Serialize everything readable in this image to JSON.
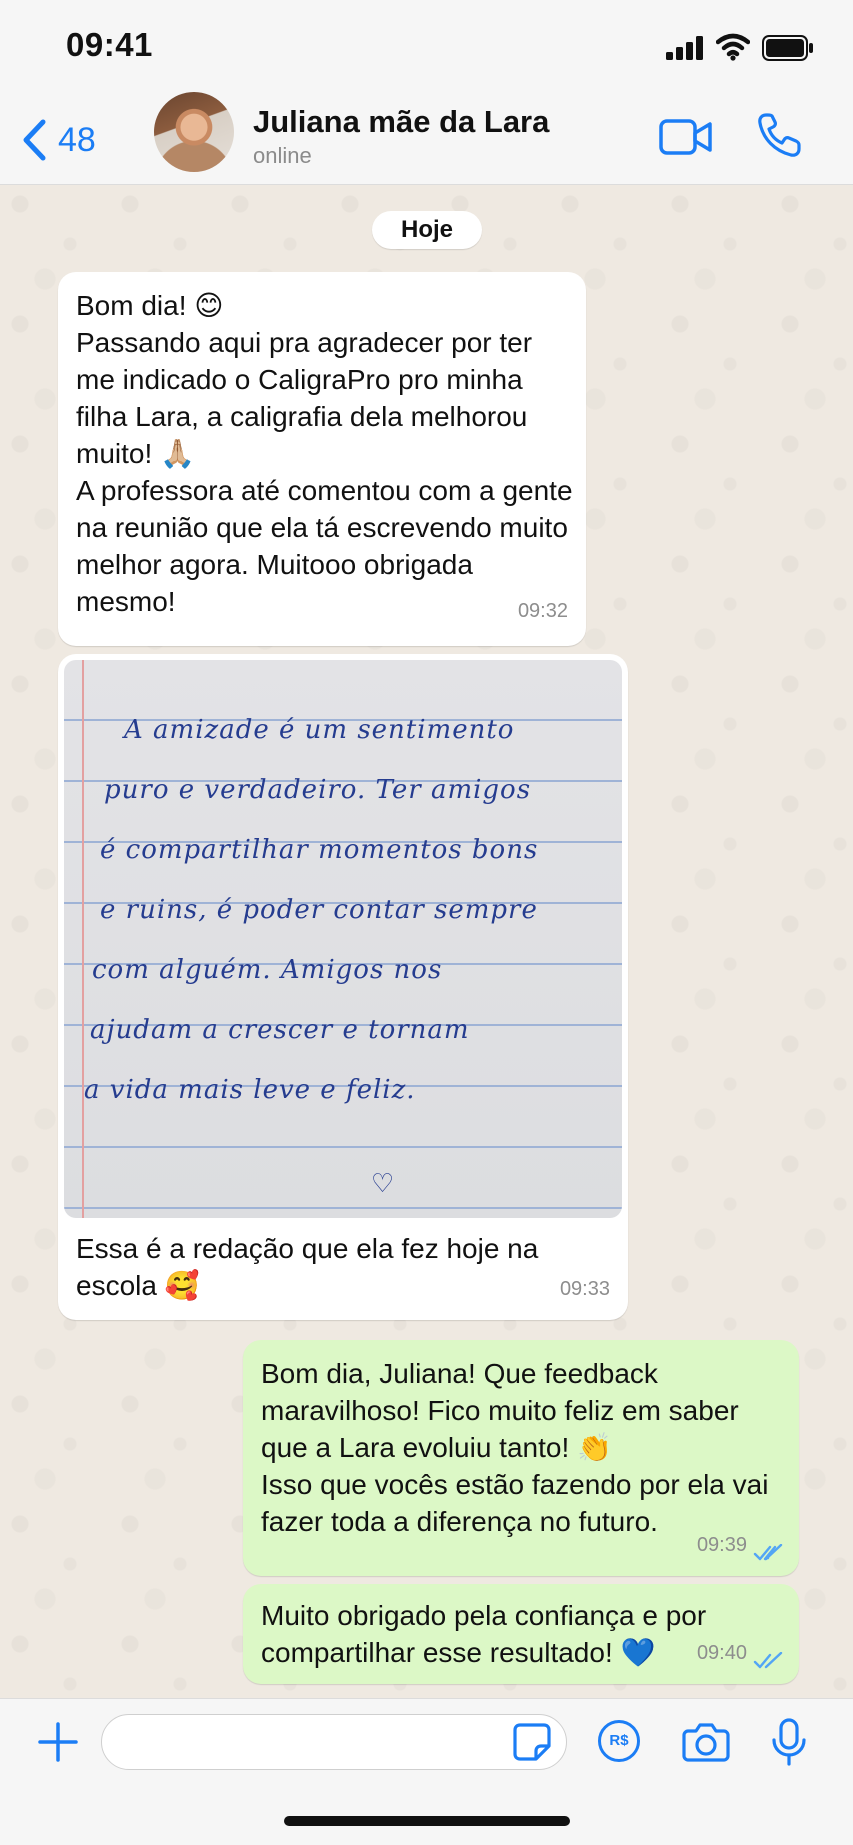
{
  "status_bar": {
    "time": "09:41"
  },
  "header": {
    "back_count": "48",
    "contact_name": "Juliana mãe da Lara",
    "contact_status": "online"
  },
  "date_chip": "Hoje",
  "messages": [
    {
      "direction": "incoming",
      "text": "Bom dia! 😊\nPassando aqui pra agradecer por ter me indicado o CaligraPro pro minha filha Lara, a caligrafia dela melhorou muito! 🙏🏼\nA professora até comentou com a gente na reunião que ela tá escrevendo muito melhor agora. Muitooo obrigada mesmo!",
      "time": "09:32"
    },
    {
      "direction": "incoming",
      "photo_lines": [
        "A amizade é um sentimento",
        "puro e verdadeiro. Ter amigos",
        "é compartilhar momentos bons",
        "e ruins, é poder contar sempre",
        "com alguém. Amigos nos",
        "ajudam a crescer e tornam",
        "a vida mais leve e feliz.",
        "♡"
      ],
      "text": "Essa é a redação que ela fez hoje na escola 🥰",
      "time": "09:33"
    },
    {
      "direction": "outgoing",
      "text": "Bom dia, Juliana! Que feedback maravilhoso! Fico muito feliz em saber que a Lara evoluiu tanto! 👏\nIsso que vocês estão fazendo por ela vai fazer toda a diferença no futuro.",
      "time": "09:39",
      "status": "read"
    },
    {
      "direction": "outgoing",
      "text": "Muito obrigado pela confiança e por compartilhar esse resultado! 💙",
      "time": "09:40",
      "status": "read"
    }
  ],
  "input": {
    "placeholder": "",
    "value": ""
  },
  "icons": {
    "back": "chevron-left-icon",
    "video_call": "video-camera-icon",
    "voice_call": "phone-icon",
    "attach": "plus-icon",
    "sticker": "sticker-icon",
    "payment": "pix-icon",
    "pix_label": "R$",
    "camera": "camera-icon",
    "mic": "microphone-icon"
  },
  "colors": {
    "accent": "#1b7df5",
    "incoming_bubble": "#ffffff",
    "outgoing_bubble": "#dcf8c6",
    "read_ticks": "#53a5f5",
    "chat_background": "#efe9e1"
  }
}
